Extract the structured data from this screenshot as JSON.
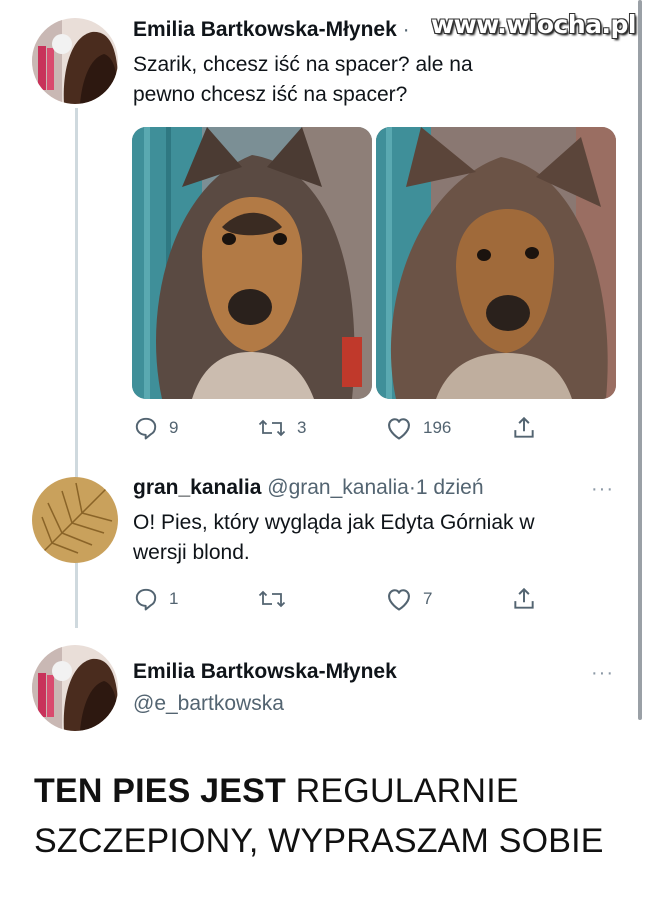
{
  "watermark": "www.wiocha.pl",
  "tweet1": {
    "author_name": "Emilia Bartkowska-Młynek",
    "separator": "·",
    "text_line1": "Szarik, chcesz iść na spacer? ale na",
    "text_line2": "pewno chcesz iść na spacer?",
    "replies": "9",
    "retweets": "3",
    "likes": "196"
  },
  "reply": {
    "author_name": "gran_kanalia",
    "handle": "@gran_kanalia",
    "separator": "·",
    "time": "1 dzień",
    "more": "···",
    "text_line1": "O! Pies, który wygląda jak Edyta Górniak w",
    "text_line2": "wersji blond.",
    "replies": "1",
    "retweets": "",
    "likes": "7"
  },
  "tweet3": {
    "author_name": "Emilia Bartkowska-Młynek",
    "handle": "@e_bartkowska",
    "more": "···",
    "text_bold": "TEN PIES JEST",
    "text_rest": " REGULARNIE",
    "text_line2": "SZCZEPIONY, WYPRASZAM SOBIE"
  },
  "icons": [
    "reply-icon",
    "retweet-icon",
    "like-icon",
    "share-icon",
    "more-icon"
  ],
  "colors": {
    "text": "#0f1419",
    "muted": "#536471",
    "thread_line": "#cfd9de"
  }
}
